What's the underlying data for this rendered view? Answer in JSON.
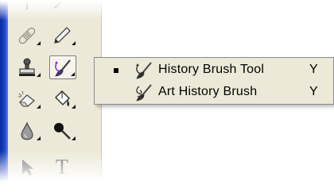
{
  "flyout_menu": {
    "items": [
      {
        "label": "History Brush Tool",
        "shortcut": "Y",
        "selected": true,
        "icon": "history-brush-icon"
      },
      {
        "label": "Art History Brush",
        "shortcut": "Y",
        "selected": false,
        "icon": "art-history-brush-icon"
      }
    ]
  },
  "toolbox": {
    "tools": [
      {
        "name": "healing-brush-tool",
        "icon": "bandage-icon"
      },
      {
        "name": "pencil-tool",
        "icon": "pencil-icon"
      },
      {
        "name": "clone-stamp-tool",
        "icon": "stamp-icon"
      },
      {
        "name": "history-brush-tool",
        "icon": "history-brush-icon",
        "active": true
      },
      {
        "name": "eraser-tool",
        "icon": "eraser-icon"
      },
      {
        "name": "paint-bucket-tool",
        "icon": "paint-bucket-icon"
      },
      {
        "name": "blur-tool",
        "icon": "droplet-icon"
      },
      {
        "name": "burn-tool",
        "icon": "burn-icon"
      },
      {
        "name": "path-selection-tool",
        "icon": "arrow-icon"
      },
      {
        "name": "type-tool",
        "icon": "type-icon"
      }
    ],
    "type_tool_glyph": "T"
  },
  "colors": {
    "panel_bg": "#ece9d8",
    "window_frame": "#1c44c8"
  }
}
